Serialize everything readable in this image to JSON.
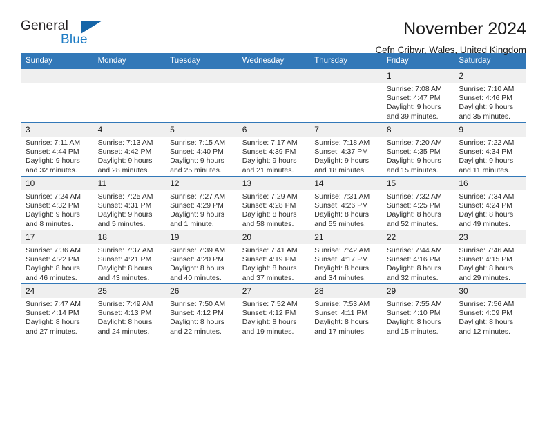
{
  "brand": {
    "word1": "General",
    "word2": "Blue",
    "triangle_color": "#1565a8",
    "blue_text_color": "#1e7cc4"
  },
  "header": {
    "title": "November 2024",
    "subtitle": "Cefn Cribwr, Wales, United Kingdom",
    "header_bg": "#3278b8",
    "header_text": "#ffffff"
  },
  "weekdays": [
    "Sunday",
    "Monday",
    "Tuesday",
    "Wednesday",
    "Thursday",
    "Friday",
    "Saturday"
  ],
  "labels": {
    "sunrise": "Sunrise:",
    "sunset": "Sunset:",
    "daylight": "Daylight:"
  },
  "weeks": [
    [
      {
        "day": "",
        "empty": true
      },
      {
        "day": "",
        "empty": true
      },
      {
        "day": "",
        "empty": true
      },
      {
        "day": "",
        "empty": true
      },
      {
        "day": "",
        "empty": true
      },
      {
        "day": "1",
        "sunrise": "Sunrise: 7:08 AM",
        "sunset": "Sunset: 4:47 PM",
        "daylight": "Daylight: 9 hours and 39 minutes."
      },
      {
        "day": "2",
        "sunrise": "Sunrise: 7:10 AM",
        "sunset": "Sunset: 4:46 PM",
        "daylight": "Daylight: 9 hours and 35 minutes."
      }
    ],
    [
      {
        "day": "3",
        "sunrise": "Sunrise: 7:11 AM",
        "sunset": "Sunset: 4:44 PM",
        "daylight": "Daylight: 9 hours and 32 minutes."
      },
      {
        "day": "4",
        "sunrise": "Sunrise: 7:13 AM",
        "sunset": "Sunset: 4:42 PM",
        "daylight": "Daylight: 9 hours and 28 minutes."
      },
      {
        "day": "5",
        "sunrise": "Sunrise: 7:15 AM",
        "sunset": "Sunset: 4:40 PM",
        "daylight": "Daylight: 9 hours and 25 minutes."
      },
      {
        "day": "6",
        "sunrise": "Sunrise: 7:17 AM",
        "sunset": "Sunset: 4:39 PM",
        "daylight": "Daylight: 9 hours and 21 minutes."
      },
      {
        "day": "7",
        "sunrise": "Sunrise: 7:18 AM",
        "sunset": "Sunset: 4:37 PM",
        "daylight": "Daylight: 9 hours and 18 minutes."
      },
      {
        "day": "8",
        "sunrise": "Sunrise: 7:20 AM",
        "sunset": "Sunset: 4:35 PM",
        "daylight": "Daylight: 9 hours and 15 minutes."
      },
      {
        "day": "9",
        "sunrise": "Sunrise: 7:22 AM",
        "sunset": "Sunset: 4:34 PM",
        "daylight": "Daylight: 9 hours and 11 minutes."
      }
    ],
    [
      {
        "day": "10",
        "sunrise": "Sunrise: 7:24 AM",
        "sunset": "Sunset: 4:32 PM",
        "daylight": "Daylight: 9 hours and 8 minutes."
      },
      {
        "day": "11",
        "sunrise": "Sunrise: 7:25 AM",
        "sunset": "Sunset: 4:31 PM",
        "daylight": "Daylight: 9 hours and 5 minutes."
      },
      {
        "day": "12",
        "sunrise": "Sunrise: 7:27 AM",
        "sunset": "Sunset: 4:29 PM",
        "daylight": "Daylight: 9 hours and 1 minute."
      },
      {
        "day": "13",
        "sunrise": "Sunrise: 7:29 AM",
        "sunset": "Sunset: 4:28 PM",
        "daylight": "Daylight: 8 hours and 58 minutes."
      },
      {
        "day": "14",
        "sunrise": "Sunrise: 7:31 AM",
        "sunset": "Sunset: 4:26 PM",
        "daylight": "Daylight: 8 hours and 55 minutes."
      },
      {
        "day": "15",
        "sunrise": "Sunrise: 7:32 AM",
        "sunset": "Sunset: 4:25 PM",
        "daylight": "Daylight: 8 hours and 52 minutes."
      },
      {
        "day": "16",
        "sunrise": "Sunrise: 7:34 AM",
        "sunset": "Sunset: 4:24 PM",
        "daylight": "Daylight: 8 hours and 49 minutes."
      }
    ],
    [
      {
        "day": "17",
        "sunrise": "Sunrise: 7:36 AM",
        "sunset": "Sunset: 4:22 PM",
        "daylight": "Daylight: 8 hours and 46 minutes."
      },
      {
        "day": "18",
        "sunrise": "Sunrise: 7:37 AM",
        "sunset": "Sunset: 4:21 PM",
        "daylight": "Daylight: 8 hours and 43 minutes."
      },
      {
        "day": "19",
        "sunrise": "Sunrise: 7:39 AM",
        "sunset": "Sunset: 4:20 PM",
        "daylight": "Daylight: 8 hours and 40 minutes."
      },
      {
        "day": "20",
        "sunrise": "Sunrise: 7:41 AM",
        "sunset": "Sunset: 4:19 PM",
        "daylight": "Daylight: 8 hours and 37 minutes."
      },
      {
        "day": "21",
        "sunrise": "Sunrise: 7:42 AM",
        "sunset": "Sunset: 4:17 PM",
        "daylight": "Daylight: 8 hours and 34 minutes."
      },
      {
        "day": "22",
        "sunrise": "Sunrise: 7:44 AM",
        "sunset": "Sunset: 4:16 PM",
        "daylight": "Daylight: 8 hours and 32 minutes."
      },
      {
        "day": "23",
        "sunrise": "Sunrise: 7:46 AM",
        "sunset": "Sunset: 4:15 PM",
        "daylight": "Daylight: 8 hours and 29 minutes."
      }
    ],
    [
      {
        "day": "24",
        "sunrise": "Sunrise: 7:47 AM",
        "sunset": "Sunset: 4:14 PM",
        "daylight": "Daylight: 8 hours and 27 minutes."
      },
      {
        "day": "25",
        "sunrise": "Sunrise: 7:49 AM",
        "sunset": "Sunset: 4:13 PM",
        "daylight": "Daylight: 8 hours and 24 minutes."
      },
      {
        "day": "26",
        "sunrise": "Sunrise: 7:50 AM",
        "sunset": "Sunset: 4:12 PM",
        "daylight": "Daylight: 8 hours and 22 minutes."
      },
      {
        "day": "27",
        "sunrise": "Sunrise: 7:52 AM",
        "sunset": "Sunset: 4:12 PM",
        "daylight": "Daylight: 8 hours and 19 minutes."
      },
      {
        "day": "28",
        "sunrise": "Sunrise: 7:53 AM",
        "sunset": "Sunset: 4:11 PM",
        "daylight": "Daylight: 8 hours and 17 minutes."
      },
      {
        "day": "29",
        "sunrise": "Sunrise: 7:55 AM",
        "sunset": "Sunset: 4:10 PM",
        "daylight": "Daylight: 8 hours and 15 minutes."
      },
      {
        "day": "30",
        "sunrise": "Sunrise: 7:56 AM",
        "sunset": "Sunset: 4:09 PM",
        "daylight": "Daylight: 8 hours and 12 minutes."
      }
    ]
  ]
}
